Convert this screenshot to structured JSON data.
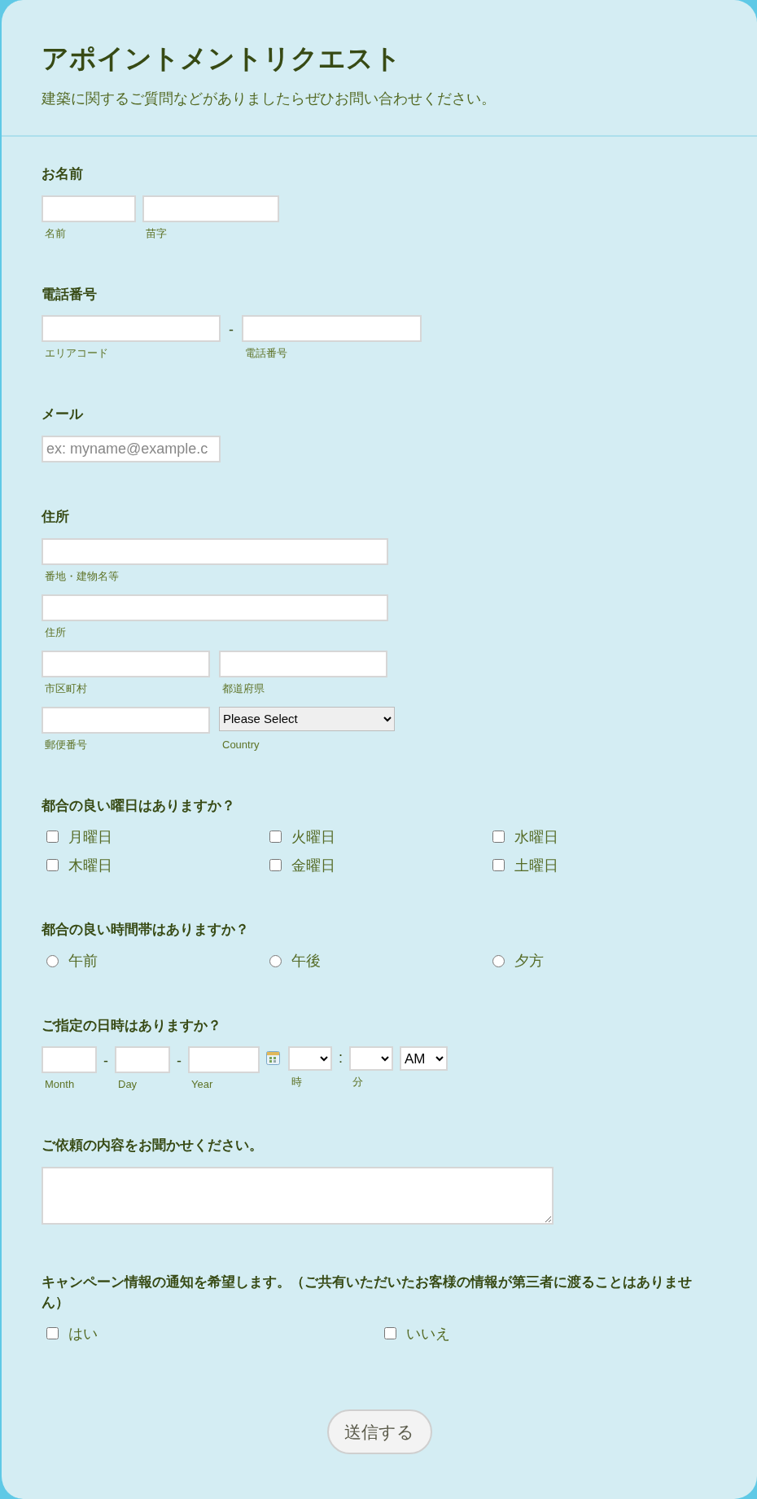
{
  "form": {
    "title": "アポイントメントリクエスト",
    "description": "建築に関するご質問などがありましたらぜひお問い合わせください。"
  },
  "fields": [
    {
      "kind": "name",
      "label": "お名前",
      "inputs": [
        {
          "sublabel": "名前"
        },
        {
          "sublabel": "苗字"
        }
      ]
    },
    {
      "kind": "phone",
      "label": "電話番号",
      "separator": "-",
      "inputs": [
        {
          "sublabel": "エリアコード"
        },
        {
          "sublabel": "電話番号"
        }
      ]
    },
    {
      "kind": "email",
      "label": "メール",
      "placeholder": "ex: myname@example.c"
    },
    {
      "kind": "address",
      "label": "住所",
      "rows": [
        [
          {
            "kind": "input",
            "sublabel": "番地・建物名等"
          }
        ],
        [
          {
            "kind": "input",
            "sublabel": "住所"
          }
        ],
        [
          {
            "kind": "input",
            "sublabel": "市区町村"
          },
          {
            "kind": "input",
            "sublabel": "都道府県"
          }
        ],
        [
          {
            "kind": "input",
            "sublabel": "郵便番号"
          },
          {
            "kind": "select",
            "value": "Please Select",
            "sublabel": "Country"
          }
        ]
      ]
    },
    {
      "kind": "checkboxes",
      "label": "都合の良い曜日はありますか？",
      "options": [
        {
          "label": "月曜日",
          "checked": false
        },
        {
          "label": "火曜日",
          "checked": false
        },
        {
          "label": "水曜日",
          "checked": false
        },
        {
          "label": "木曜日",
          "checked": false
        },
        {
          "label": "金曜日",
          "checked": false
        },
        {
          "label": "土曜日",
          "checked": false
        }
      ]
    },
    {
      "kind": "radios",
      "label": "都合の良い時間帯はありますか？",
      "options": [
        {
          "label": "午前",
          "selected": false
        },
        {
          "label": "午後",
          "selected": false
        },
        {
          "label": "夕方",
          "selected": false
        }
      ]
    },
    {
      "kind": "datetime",
      "label": "ご指定の日時はありますか？",
      "date": [
        {
          "sublabel": "Month"
        },
        {
          "sublabel": "Day"
        },
        {
          "sublabel": "Year"
        }
      ],
      "date_separator": "-",
      "hour_sublabel": "時",
      "time_separator": ":",
      "minute_sublabel": "分",
      "ampm": "AM"
    },
    {
      "kind": "textarea",
      "label": "ご依頼の内容をお聞かせください。"
    },
    {
      "kind": "consent",
      "label": "キャンペーン情報の通知を希望します。（ご共有いただいたお客様の情報が第三者に渡ることはありません）",
      "options": [
        {
          "label": "はい",
          "checked": false
        },
        {
          "label": "いいえ",
          "checked": false
        }
      ]
    }
  ],
  "submit": "送信する"
}
